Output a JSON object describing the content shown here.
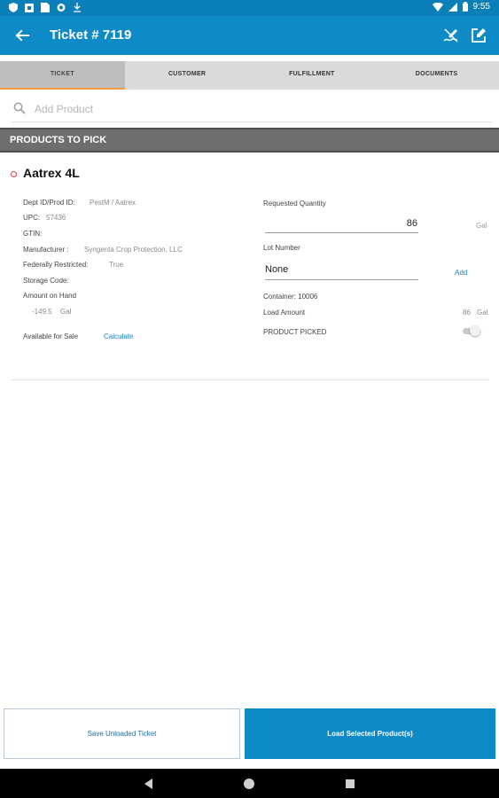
{
  "status_bar": {
    "time": "9:55"
  },
  "app_bar": {
    "title": "Ticket # 7119"
  },
  "tabs": [
    {
      "label": "TICKET",
      "active": true
    },
    {
      "label": "CUSTOMER",
      "active": false
    },
    {
      "label": "FULFILLMENT",
      "active": false
    },
    {
      "label": "DOCUMENTS",
      "active": false
    }
  ],
  "search": {
    "placeholder": "Add Product"
  },
  "section": {
    "title": "PRODUCTS TO PICK"
  },
  "product": {
    "name": "Aatrex 4L",
    "dept_label": "Dept ID/Prod ID:",
    "dept_value": "PestM / Aatrex",
    "upc_label": "UPC:",
    "upc_value": "57436",
    "gtin_label": "GTIN:",
    "manufacturer_label": "Manufacturer :",
    "manufacturer_value": "Syngenta Crop Protection, LLC",
    "restricted_label": "Federally Restricted:",
    "restricted_value": "True",
    "storage_label": "Storage Code:",
    "amount_label": "Amount on Hand",
    "amount_value": "-149.5",
    "amount_unit": "Gal",
    "available_label": "Available for Sale",
    "calculate_label": "Calculate",
    "requested_label": "Requested Quantity",
    "requested_value": "86",
    "requested_unit": "Gal",
    "lot_label": "Lot Number",
    "lot_value": "None",
    "add_label": "Add",
    "container_label": "Container: 10006",
    "load_label": "Load Amount",
    "load_value": "86",
    "load_unit": "Gal",
    "picked_label": "PRODUCT PICKED",
    "picked": false
  },
  "buttons": {
    "save": "Save Unloaded Ticket",
    "load": "Load Selected Product(s)"
  },
  "colors": {
    "status_bar": "#0b7fb7",
    "app_bar": "#0e8ac6",
    "tab_indicator": "#f39c3c",
    "section_bar": "#6e6e6e",
    "link": "#1a7fc1"
  }
}
